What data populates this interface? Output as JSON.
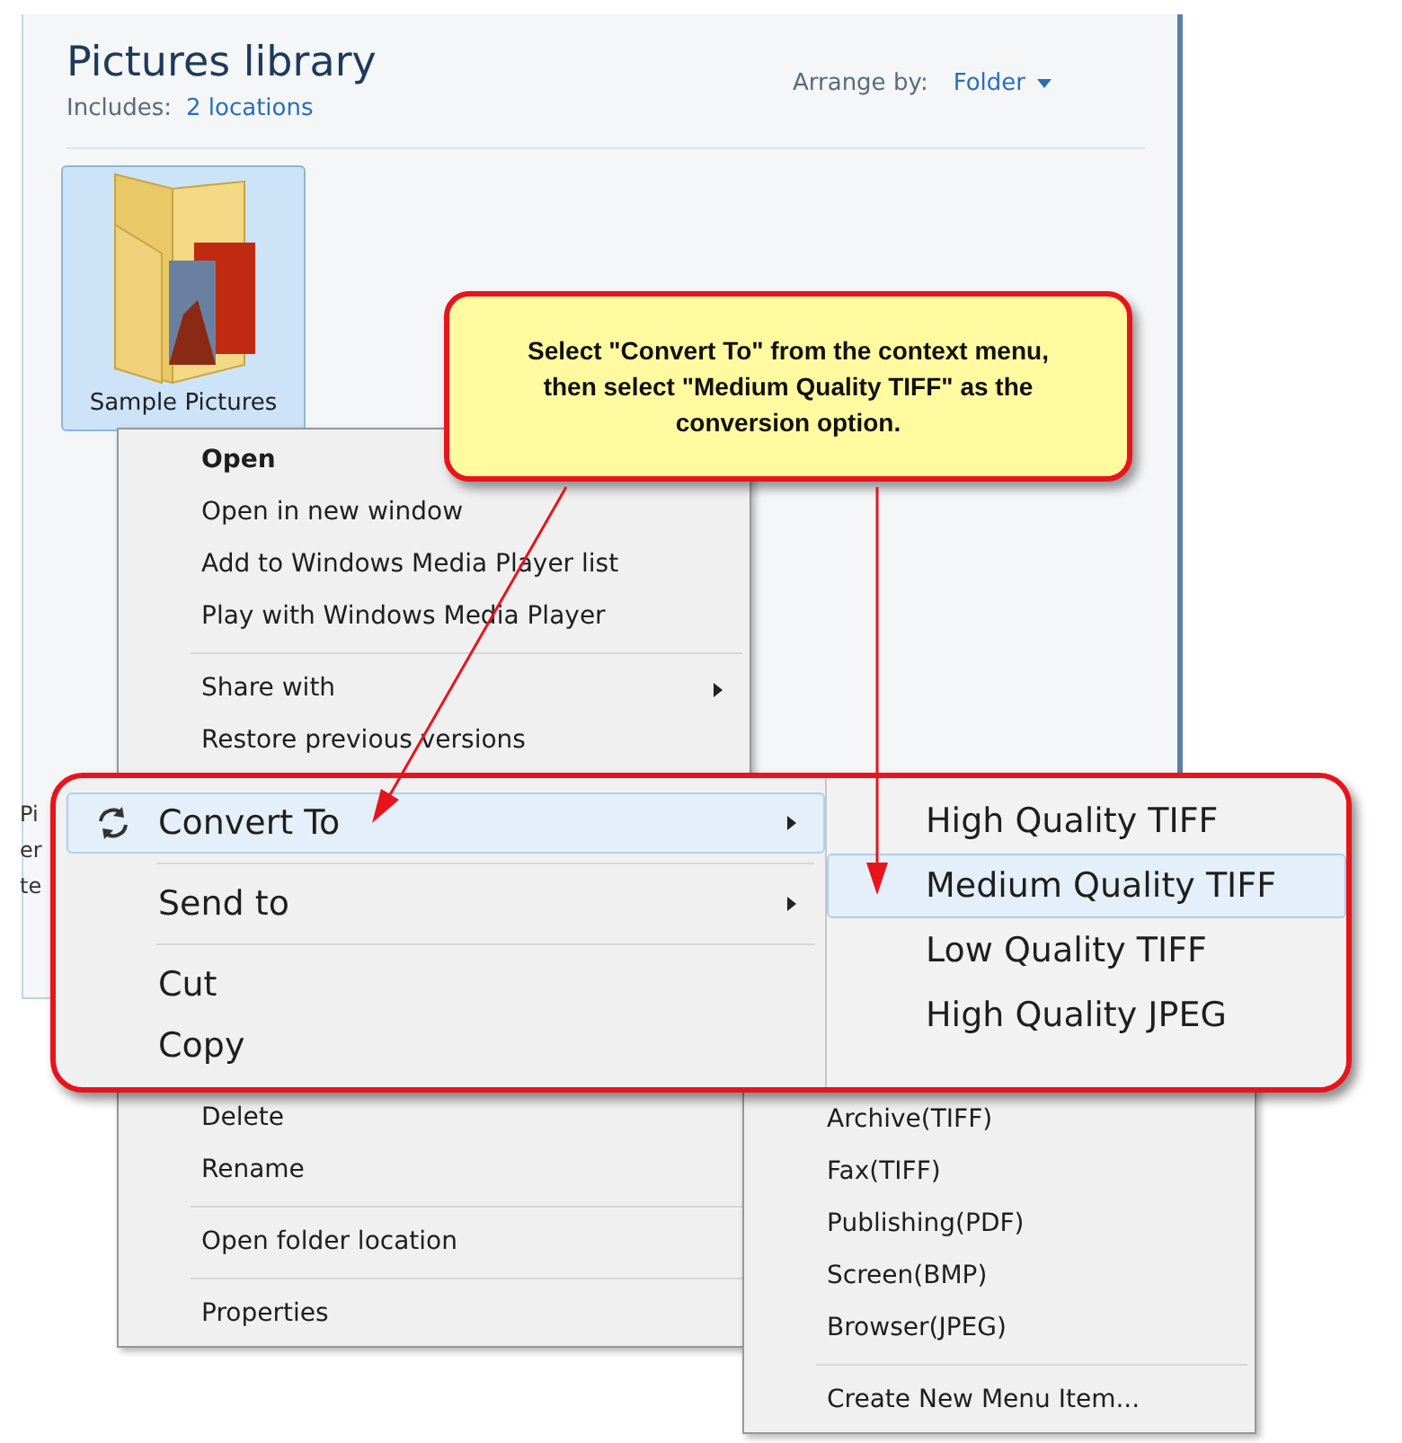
{
  "window": {
    "title": "Pictures library",
    "includes_label": "Includes:",
    "locations_link": "2 locations",
    "arrange_label": "Arrange by:",
    "arrange_value": "Folder"
  },
  "folder": {
    "label": "Sample Pictures",
    "selected": true
  },
  "details_pane_fragments": [
    "Pi",
    "er",
    "te"
  ],
  "context_menu": {
    "top_items": [
      {
        "kind": "item",
        "label": "Open",
        "default": true
      },
      {
        "kind": "item",
        "label": "Open in new window",
        "default": false
      },
      {
        "kind": "item",
        "label": "Add to Windows Media Player list",
        "default": false
      },
      {
        "kind": "item",
        "label": "Play with Windows Media Player",
        "default": false
      },
      {
        "kind": "separator"
      },
      {
        "kind": "submenu",
        "label": "Share with",
        "default": false
      },
      {
        "kind": "item",
        "label": "Restore previous versions",
        "default": false
      }
    ],
    "bottom_items": [
      {
        "kind": "item",
        "label": "Delete",
        "default": false
      },
      {
        "kind": "item",
        "label": "Rename",
        "default": false
      },
      {
        "kind": "separator"
      },
      {
        "kind": "item",
        "label": "Open folder location",
        "default": false
      },
      {
        "kind": "separator"
      },
      {
        "kind": "item",
        "label": "Properties",
        "default": false
      }
    ]
  },
  "submenu": {
    "items": [
      {
        "kind": "item",
        "label": "Archive(TIFF)"
      },
      {
        "kind": "item",
        "label": "Fax(TIFF)"
      },
      {
        "kind": "item",
        "label": "Publishing(PDF)"
      },
      {
        "kind": "item",
        "label": "Screen(BMP)"
      },
      {
        "kind": "item",
        "label": "Browser(JPEG)"
      },
      {
        "kind": "separator"
      },
      {
        "kind": "item",
        "label": "Create New Menu Item..."
      }
    ]
  },
  "zoom_inset": {
    "menu_items": [
      {
        "kind": "submenu",
        "label": "Convert To",
        "has_icon": true,
        "selected": true
      },
      {
        "kind": "separator"
      },
      {
        "kind": "submenu",
        "label": "Send to",
        "has_icon": false,
        "selected": false
      },
      {
        "kind": "separator"
      },
      {
        "kind": "item",
        "label": "Cut",
        "has_icon": false,
        "selected": false
      },
      {
        "kind": "item",
        "label": "Copy",
        "has_icon": false,
        "selected": false
      }
    ],
    "submenu_items": [
      {
        "label": "High Quality TIFF",
        "selected": false
      },
      {
        "label": "Medium Quality TIFF",
        "selected": true
      },
      {
        "label": "Low Quality TIFF",
        "selected": false
      },
      {
        "label": "High Quality JPEG",
        "selected": false
      }
    ]
  },
  "callout": {
    "text": "Select \"Convert To\" from the context menu, then select \"Medium Quality TIFF\" as the conversion option."
  }
}
